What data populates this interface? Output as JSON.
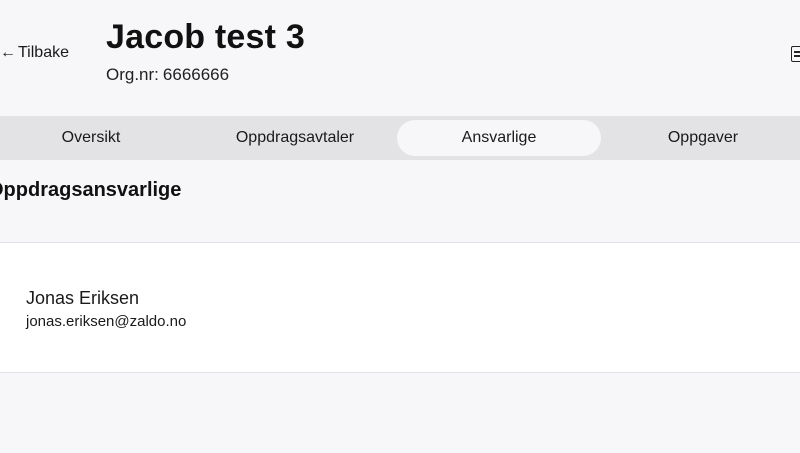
{
  "header": {
    "back_label": "Tilbake",
    "back_arrow": "←",
    "title": "Jacob test 3",
    "org_label": "Org.nr:",
    "org_number": "6666666",
    "right_icon": "document-icon"
  },
  "tabs": [
    {
      "label": "Oversikt",
      "active": false
    },
    {
      "label": "Oppdragsavtaler",
      "active": false
    },
    {
      "label": "Ansvarlige",
      "active": true
    },
    {
      "label": "Oppgaver",
      "active": false
    }
  ],
  "section": {
    "heading": "Oppdragsansvarlige"
  },
  "responsible": {
    "name": "Jonas Eriksen",
    "email": "jonas.eriksen@zaldo.no"
  },
  "colors": {
    "page_background": "#f7f7fa",
    "tab_bar": "#e3e3e6",
    "active_tab": "#f7f7fa",
    "card": "#ffffff",
    "text": "#1a1a1a"
  }
}
